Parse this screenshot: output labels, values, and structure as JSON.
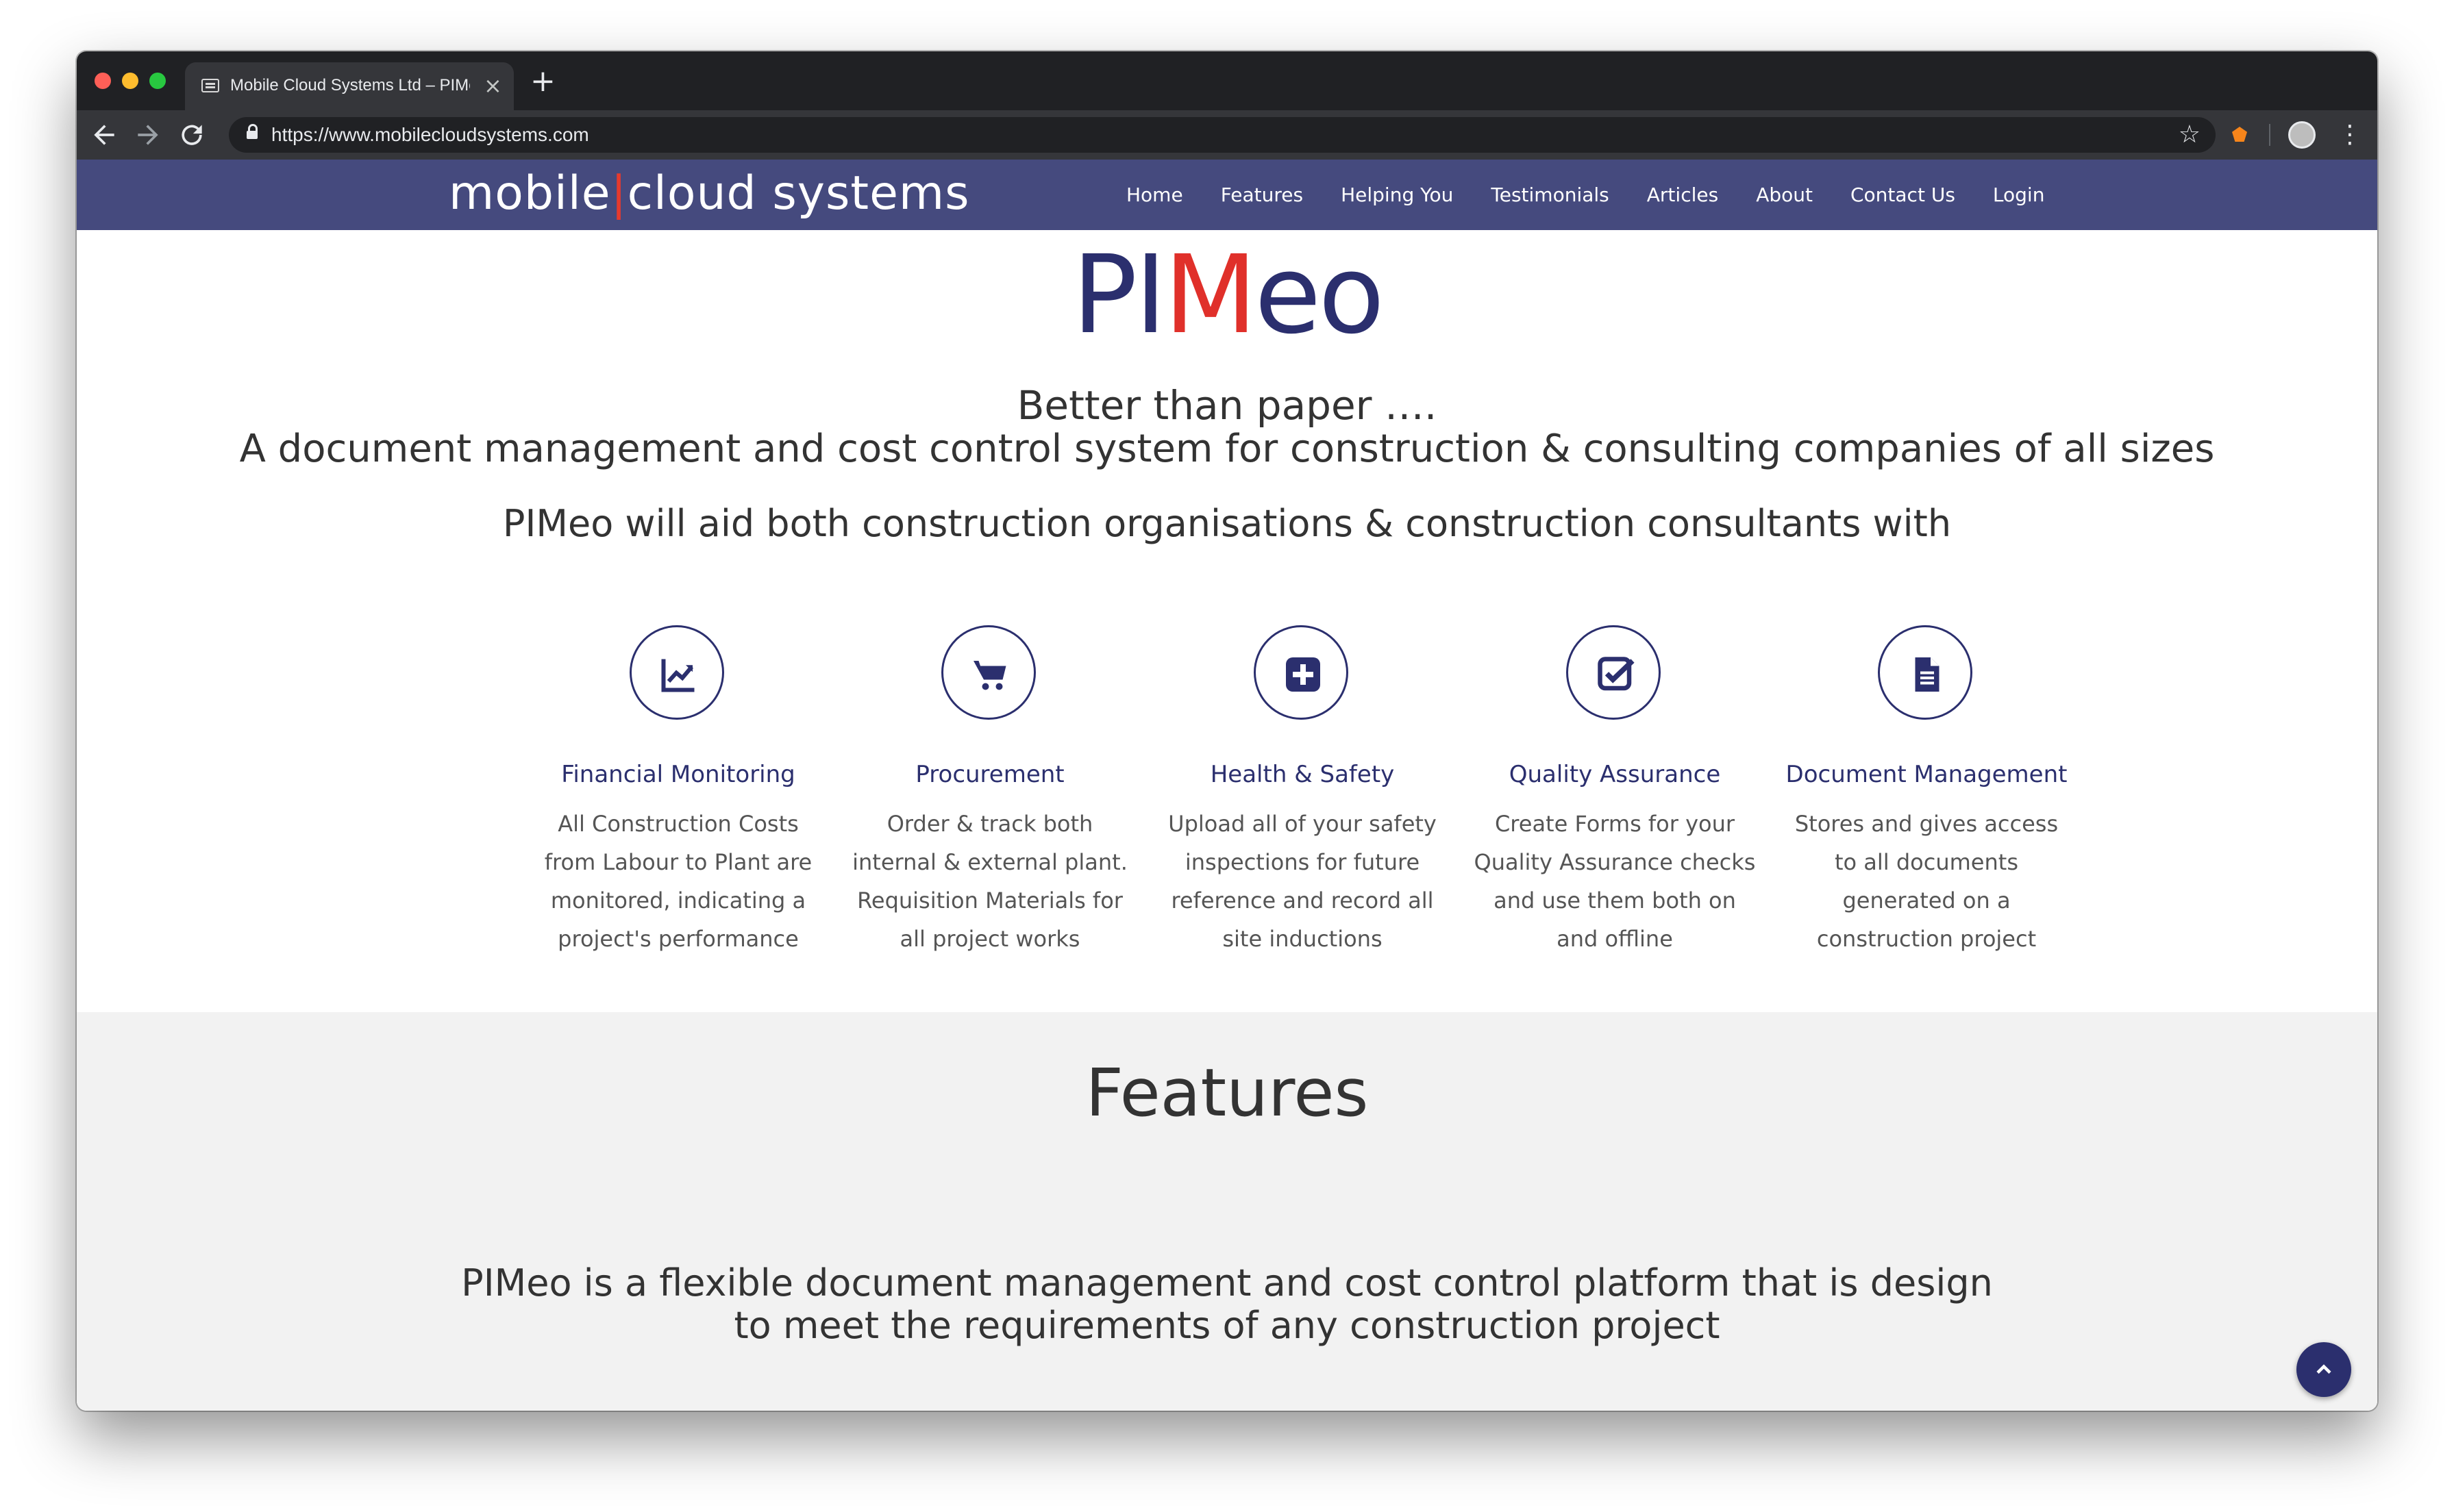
{
  "browser": {
    "tab_title": "Mobile Cloud Systems Ltd – PIMeo",
    "new_tab": "+",
    "close_tab": "×",
    "url": "https://www.mobilecloudsystems.com"
  },
  "site": {
    "brand_left": "mobile",
    "brand_sep": "|",
    "brand_right": "cloud systems",
    "nav": [
      "Home",
      "Features",
      "Helping You",
      "Testimonials",
      "Articles",
      "About",
      "Contact Us",
      "Login"
    ]
  },
  "hero": {
    "logo_a": "PI",
    "logo_b": "M",
    "logo_c": "eo",
    "tagline_1": "Better than paper ….",
    "tagline_2": "A document management and cost control system for construction & consulting companies of all sizes",
    "tagline_3": "PIMeo will aid both construction organisations & construction consultants with"
  },
  "features": [
    {
      "icon": "line-chart-icon",
      "title": "Financial Monitoring",
      "desc": "All Construction Costs from Labour to Plant are monitored, indicating a project's performance"
    },
    {
      "icon": "shopping-cart-icon",
      "title": "Procurement",
      "desc": "Order & track both internal & external plant. Requisition Materials for all project works"
    },
    {
      "icon": "medical-plus-icon",
      "title": "Health & Safety",
      "desc": "Upload all of your safety inspections for future reference and record all site inductions"
    },
    {
      "icon": "check-square-icon",
      "title": "Quality Assurance",
      "desc": "Create Forms for your Quality Assurance checks and use them both on and offline"
    },
    {
      "icon": "document-icon",
      "title": "Document Management",
      "desc": "Stores and gives access to all documents generated on a construction project"
    }
  ],
  "features_section": {
    "heading": "Features",
    "text": "PIMeo is a flexible document management and cost control platform that is design to meet the requirements of any construction project"
  },
  "colors": {
    "nav_bg": "#454a7e",
    "brand_navy": "#2b2f6e",
    "accent_red": "#e0302a",
    "section_grey": "#f2f2f2"
  }
}
